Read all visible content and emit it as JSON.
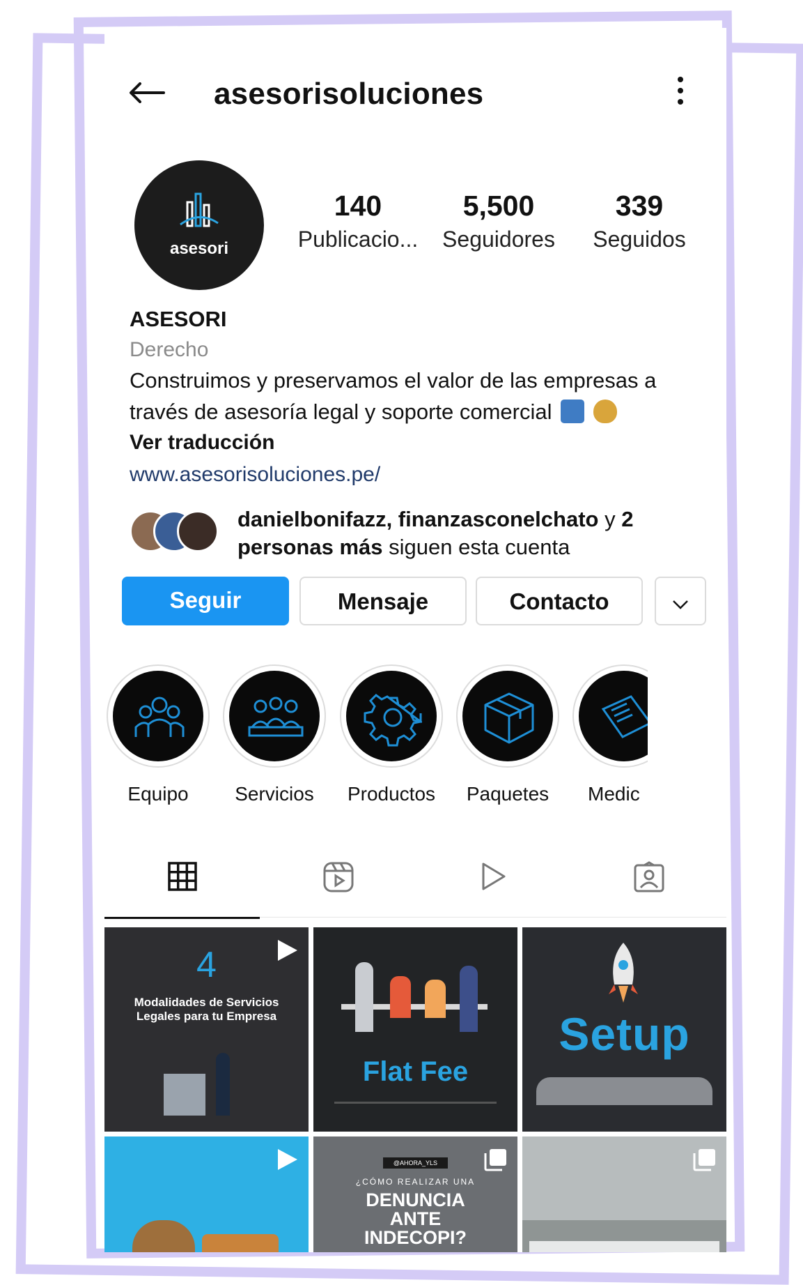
{
  "header": {
    "username": "asesorisoluciones"
  },
  "profile": {
    "avatar_word": "asesori",
    "stats": [
      {
        "value": "140",
        "label": "Publicacio..."
      },
      {
        "value": "5,500",
        "label": "Seguidores"
      },
      {
        "value": "339",
        "label": "Seguidos"
      }
    ],
    "name": "ASESORI",
    "category": "Derecho",
    "bio_line1": "Construimos y preservamos el valor de las empresas a",
    "bio_line2": "través de asesoría legal y soporte comercial",
    "translate": "Ver traducción",
    "link": "www.asesorisoluciones.pe/",
    "followed_by": {
      "names": "danielbonifazz, finanzasconelchato",
      "connector": "y",
      "more_bold": "2 personas más",
      "suffix": "siguen esta cuenta"
    }
  },
  "actions": {
    "follow": "Seguir",
    "message": "Mensaje",
    "contact": "Contacto"
  },
  "highlights": [
    {
      "label": "Equipo",
      "icon": "team-icon"
    },
    {
      "label": "Servicios",
      "icon": "services-icon"
    },
    {
      "label": "Productos",
      "icon": "gear-icon"
    },
    {
      "label": "Paquetes",
      "icon": "box-icon"
    },
    {
      "label": "Medic",
      "icon": "newspaper-icon"
    }
  ],
  "tabs": [
    {
      "name": "grid",
      "icon": "grid-icon"
    },
    {
      "name": "reels",
      "icon": "reels-icon"
    },
    {
      "name": "videos",
      "icon": "play-icon"
    },
    {
      "name": "tagged",
      "icon": "tagged-icon"
    }
  ],
  "posts": [
    {
      "big": "4",
      "text": "Modalidades de Servicios Legales para tu Empresa",
      "badge": "video"
    },
    {
      "big": "Flat Fee",
      "text": "",
      "badge": "none"
    },
    {
      "big": "Setup",
      "text": "",
      "badge": "none"
    },
    {
      "big": "",
      "text": "",
      "badge": "video"
    },
    {
      "small": "@AHORA_YLS",
      "kicker": "¿CÓMO REALIZAR UNA",
      "big": "DENUNCIA ANTE INDECOPI?",
      "badge": "carousel"
    },
    {
      "big": "",
      "text": "",
      "badge": "carousel"
    }
  ],
  "colors": {
    "accent": "#1a95f2",
    "frame": "#d4cbf6",
    "link": "#203a6a"
  }
}
